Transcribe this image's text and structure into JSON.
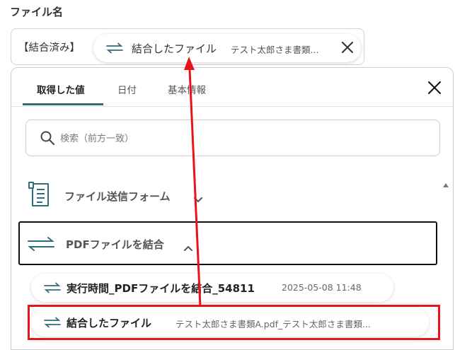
{
  "field": {
    "label": "ファイル名",
    "prefix": "【結合済み】",
    "chip": {
      "label": "結合したファイル",
      "value": "テスト太郎さま書類..."
    }
  },
  "panel": {
    "tabs": [
      {
        "label": "取得した値",
        "active": true
      },
      {
        "label": "日付",
        "active": false
      },
      {
        "label": "基本情報",
        "active": false
      }
    ],
    "search": {
      "placeholder": "検索（前方一致）"
    },
    "sections": [
      {
        "label": "ファイル送信フォーム",
        "icon": "form-document-icon",
        "expanded": false
      },
      {
        "label": "PDFファイルを結合",
        "icon": "swap-arrows-icon",
        "expanded": true
      }
    ],
    "items": [
      {
        "label": "実行時間_PDFファイルを結合_54811",
        "value": "2025-05-08 11:48"
      },
      {
        "label": "結合したファイル",
        "value": "テスト太郎さま書類A.pdf_テスト太郎さま書類..."
      }
    ]
  },
  "colors": {
    "accent": "#2f6d7b",
    "highlight": "#e8141a"
  }
}
